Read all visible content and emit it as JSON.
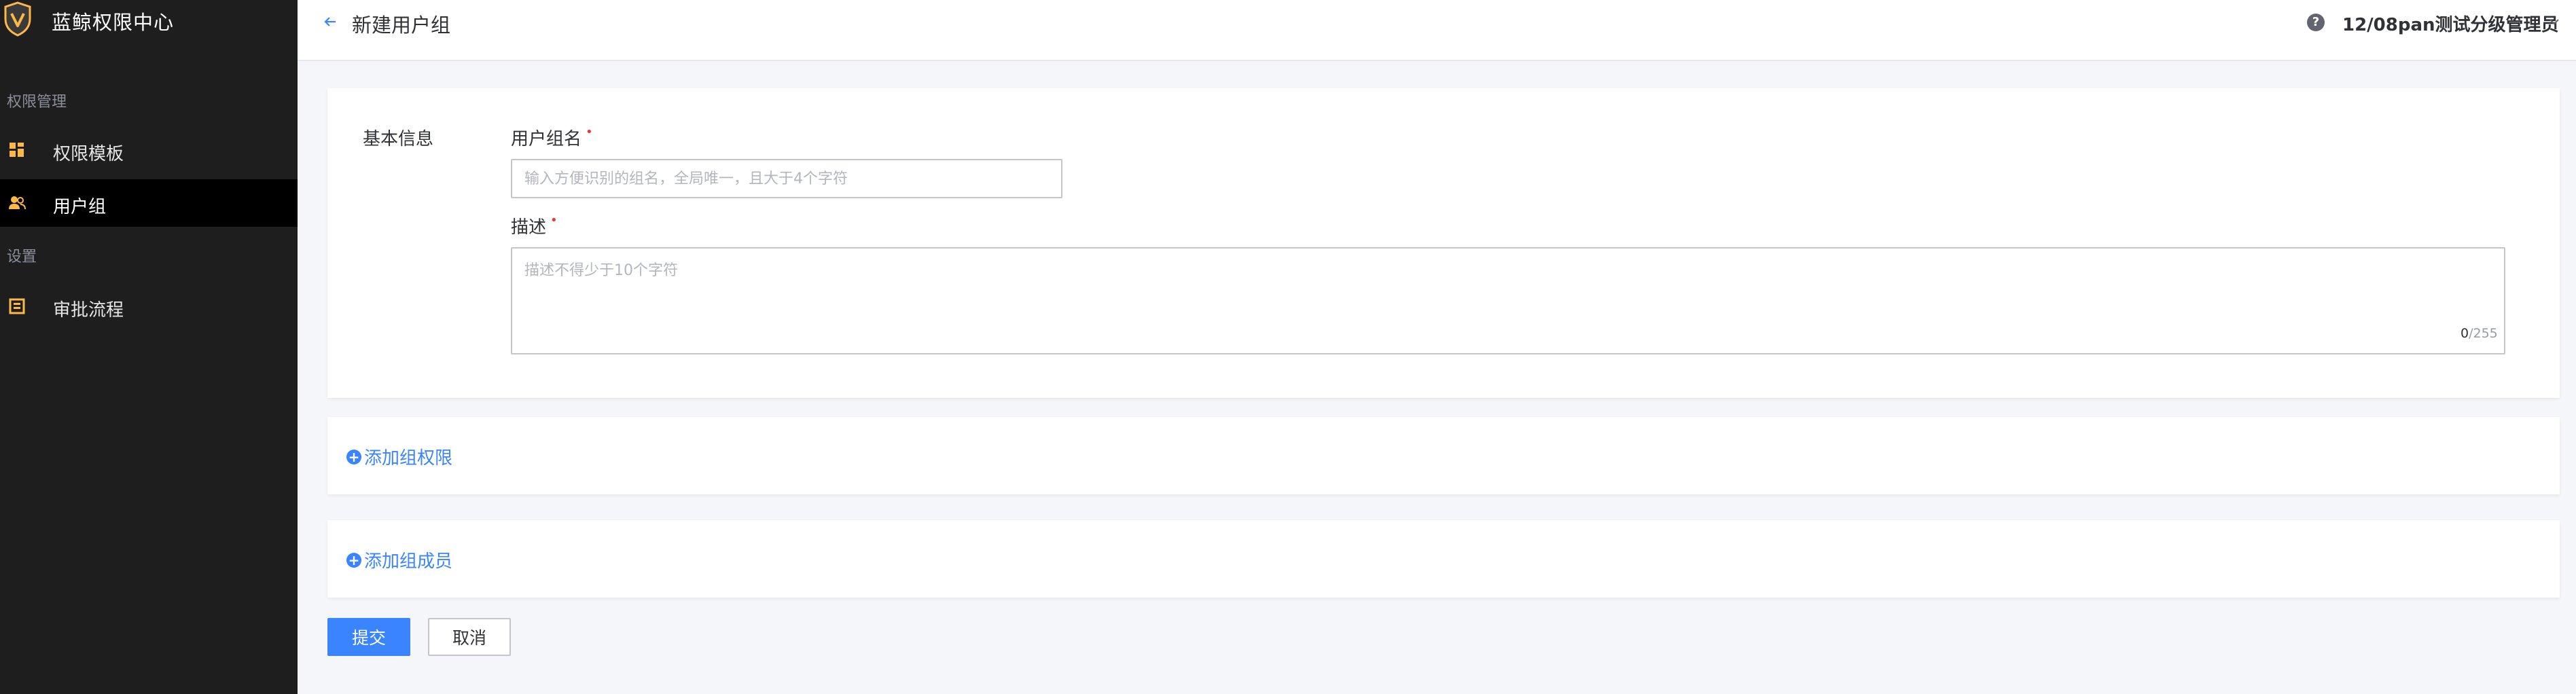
{
  "app": {
    "title": "蓝鲸权限中心"
  },
  "sidebar": {
    "groups": [
      {
        "label": "权限管理",
        "items": [
          {
            "label": "权限模板",
            "icon": "template-icon"
          },
          {
            "label": "用户组",
            "icon": "user-group-icon",
            "active": true
          }
        ]
      },
      {
        "label": "设置",
        "items": [
          {
            "label": "审批流程",
            "icon": "approval-icon"
          }
        ]
      }
    ]
  },
  "header": {
    "title": "新建用户组",
    "user": "12/08pan测试分级管理员",
    "help": "?"
  },
  "form": {
    "section_title": "基本信息",
    "name_label": "用户组名",
    "name_placeholder": "输入方便识别的组名，全局唯一，且大于4个字符",
    "desc_label": "描述",
    "desc_placeholder": "描述不得少于10个字符",
    "counter_current": "0",
    "counter_max": "/255"
  },
  "add_permission": "添加组权限",
  "add_member": "添加组成员",
  "actions": {
    "submit": "提交",
    "cancel": "取消"
  },
  "colors": {
    "primary": "#3a84ff",
    "sidebar": "#1e1e1e",
    "brand_gold": "#ffb848"
  }
}
